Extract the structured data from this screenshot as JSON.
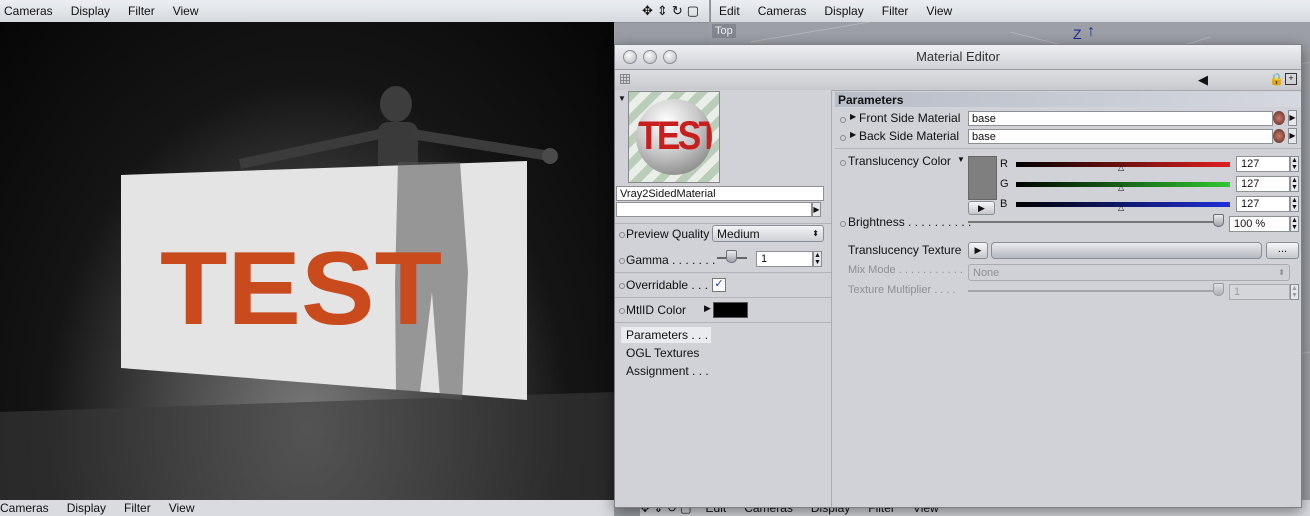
{
  "left_viewport": {
    "menu": [
      "Cameras",
      "Display",
      "Filter",
      "View"
    ],
    "render_text": "TEST"
  },
  "right_viewport": {
    "menu": [
      "Edit",
      "Cameras",
      "Display",
      "Filter",
      "View"
    ],
    "view_label": "Top",
    "axis_label": "Z"
  },
  "bottom_left_menu": [
    "Cameras",
    "Display",
    "Filter",
    "View"
  ],
  "bottom_right_menu": [
    "Edit",
    "Cameras",
    "Display",
    "Filter",
    "View"
  ],
  "material_editor": {
    "title": "Material Editor",
    "preview_text": "TEST",
    "material_name": "Vray2SidedMaterial",
    "preview_quality_label": "Preview Quality",
    "preview_quality_value": "Medium",
    "gamma_label": "Gamma . . . . . . .",
    "gamma_value": "1",
    "overridable_label": "Overridable . . .",
    "overridable_checked": true,
    "mtlid_label": "MtlID Color",
    "mtlid_color": "#000000",
    "channels": [
      "Parameters . . . .",
      "OGL Textures",
      "Assignment . . ."
    ],
    "parameters_header": "Parameters",
    "front_side_label": "Front Side Material",
    "front_side_value": "base",
    "back_side_label": "Back Side Material",
    "back_side_value": "base",
    "translucency_color_label": "Translucency Color",
    "translucency_swatch_color": "#7f7f7f",
    "r_label": "R",
    "r_value": "127",
    "g_label": "G",
    "g_value": "127",
    "b_label": "B",
    "b_value": "127",
    "brightness_label": "Brightness . . . . . . . . . .",
    "brightness_value": "100 %",
    "translucency_texture_label": "Translucency Texture",
    "translucency_texture_btn": "...",
    "mix_mode_label": "Mix Mode . . . . . . . . . . .",
    "mix_mode_value": "None",
    "texture_multiplier_label": "Texture Multiplier . . . .",
    "texture_multiplier_value": "1"
  }
}
